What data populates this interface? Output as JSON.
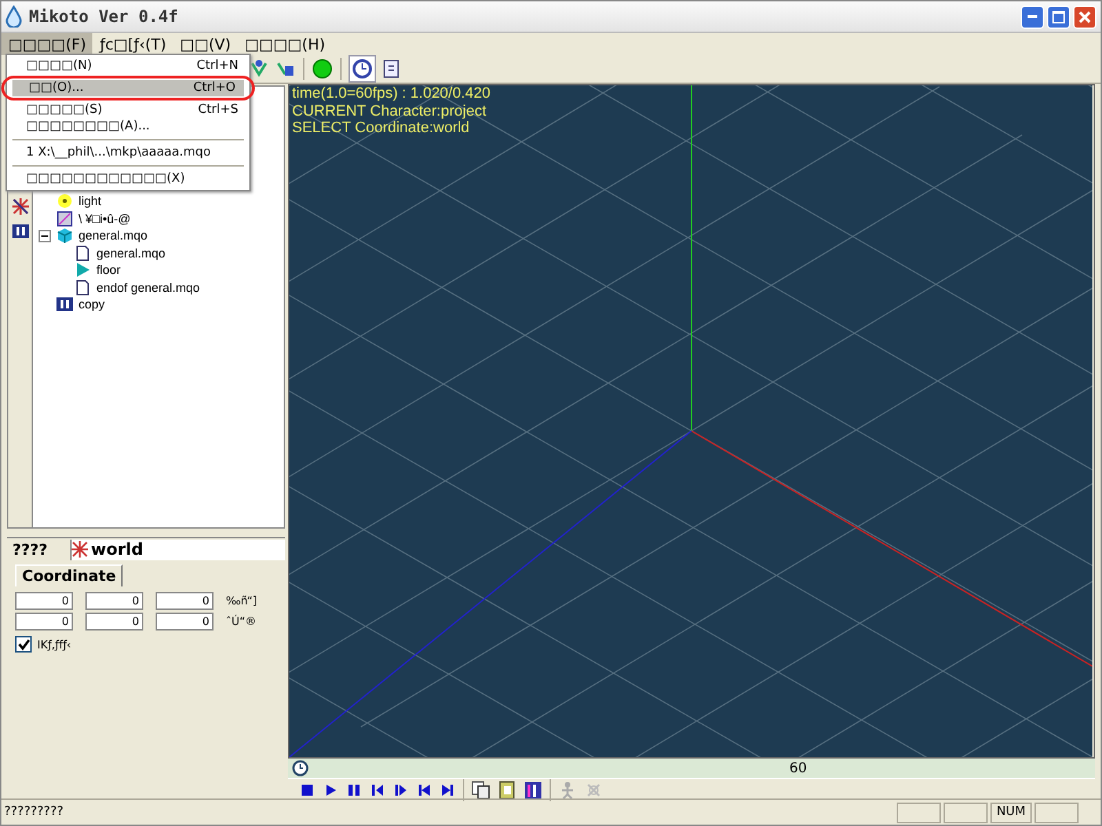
{
  "window": {
    "title": "Mikoto Ver 0.4f"
  },
  "menu_bar": [
    {
      "label": "□□□□(F)",
      "selected": true
    },
    {
      "label": "ƒc□[ƒ‹(T)",
      "selected": false
    },
    {
      "label": "□□(V)",
      "selected": false
    },
    {
      "label": "□□□□(H)",
      "selected": false
    }
  ],
  "file_menu": [
    {
      "kind": "item",
      "label": "□□□□(N)",
      "shortcut": "Ctrl+N",
      "selected": false
    },
    {
      "kind": "item",
      "label": "□□(O)...",
      "shortcut": "Ctrl+O",
      "selected": true
    },
    {
      "kind": "item",
      "label": "□□□□□(S)",
      "shortcut": "Ctrl+S",
      "selected": false
    },
    {
      "kind": "item",
      "label": "□□□□□□□□(A)...",
      "selected": false
    },
    {
      "kind": "recent",
      "label": "1 X:\\__phil\\...\\mkp\\aaaaa.mqo",
      "selected": false
    },
    {
      "kind": "item",
      "label": "□□□□□□□□□□□□(X)",
      "selected": false
    }
  ],
  "tree": [
    {
      "label": "light",
      "kind": "light"
    },
    {
      "label": "\\ ¥□i•û-@",
      "kind": "image"
    },
    {
      "label": "general.mqo",
      "kind": "model",
      "expanded": true,
      "children": [
        {
          "label": "general.mqo",
          "kind": "file"
        },
        {
          "label": "floor",
          "kind": "bone"
        },
        {
          "label": "endof general.mqo",
          "kind": "file"
        }
      ]
    },
    {
      "label": "copy",
      "kind": "motion"
    }
  ],
  "property_panel": {
    "label": "????",
    "value": "world",
    "tab": "Coordinate",
    "rows": [
      {
        "values": [
          "0",
          "0",
          "0"
        ],
        "unit": "‰ñ“]"
      },
      {
        "values": [
          "0",
          "0",
          "0"
        ],
        "unit": "ˆÚ“®"
      }
    ],
    "checkbox": {
      "label": "IKƒ‚ƒfƒ‹",
      "checked": true
    }
  },
  "viewport": {
    "lines": [
      "time(1.0=60fps) : 1.020/0.420",
      "CURRENT Character:project",
      "SELECT Coordinate:world"
    ]
  },
  "timeline": {
    "marker": "60"
  },
  "status_bar": {
    "text": "?????????",
    "indicator": "NUM"
  }
}
